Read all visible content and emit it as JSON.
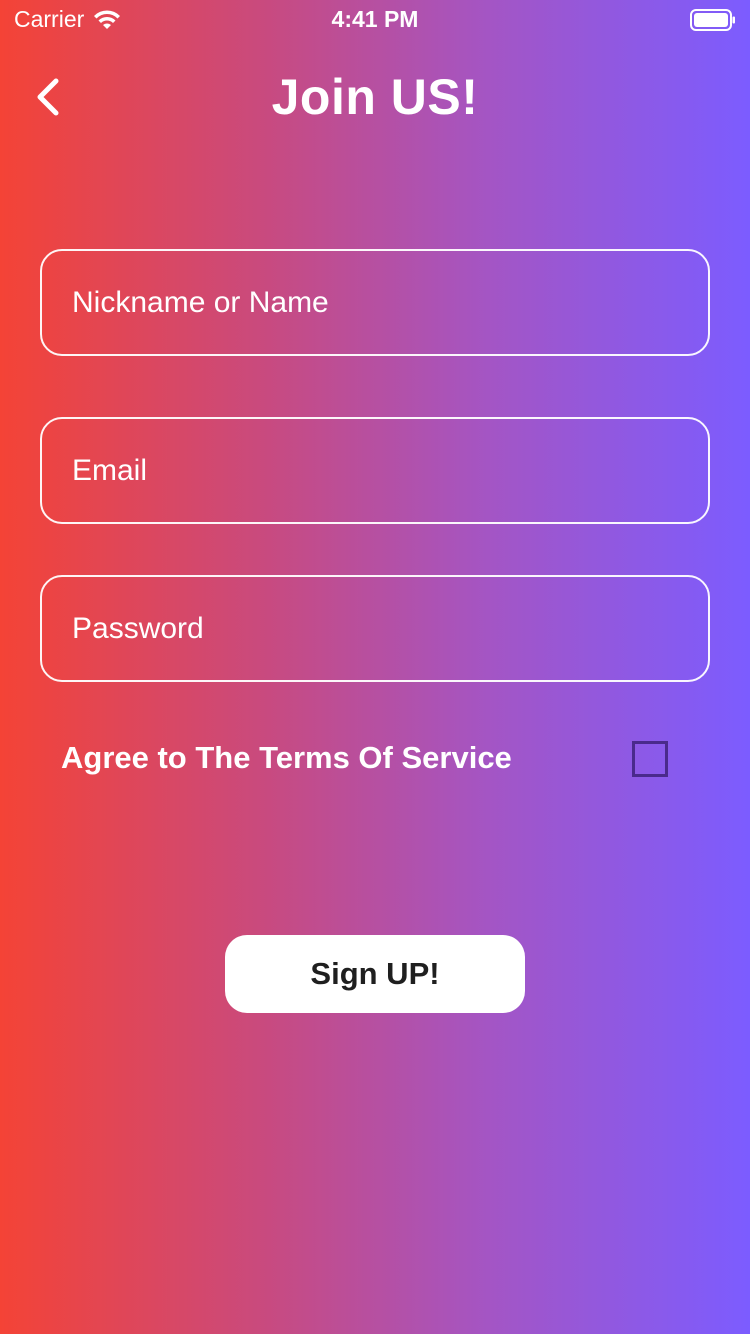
{
  "status_bar": {
    "carrier": "Carrier",
    "time": "4:41 PM",
    "wifi_icon": "wifi-icon",
    "battery_icon": "battery-icon"
  },
  "header": {
    "back_icon": "chevron-left-icon",
    "title": "Join US!"
  },
  "form": {
    "name_placeholder": "Nickname or Name",
    "name_value": "",
    "email_placeholder": "Email",
    "email_value": "",
    "password_placeholder": "Password",
    "password_value": "",
    "terms_label": "Agree to The Terms Of Service",
    "terms_checked": false,
    "submit_label": "Sign UP!"
  },
  "colors": {
    "gradient_start": "#f44336",
    "gradient_end": "#7c5cff",
    "checkbox_border": "#4a2a8c",
    "button_bg": "#ffffff",
    "button_text": "#1f1f1f"
  }
}
